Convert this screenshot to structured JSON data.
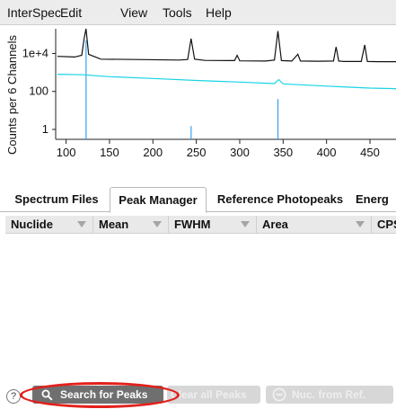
{
  "menubar": {
    "items": [
      "InterSpec",
      "Edit",
      "View",
      "Tools",
      "Help"
    ]
  },
  "chart_data": {
    "type": "line",
    "ylabel": "Counts per 6 Channels",
    "yscale": "log",
    "ylim": [
      0.3,
      200000
    ],
    "y_ticks": [
      1,
      100,
      10000
    ],
    "y_tick_labels": [
      "1",
      "100",
      "1e+4"
    ],
    "xlim": [
      88,
      480
    ],
    "x_ticks": [
      100,
      150,
      200,
      250,
      300,
      350,
      400,
      450
    ],
    "series": [
      {
        "color": "#111111",
        "x": [
          90,
          110,
          118,
          121,
          123,
          126,
          140,
          180,
          230,
          240,
          244,
          248,
          260,
          294,
          297,
          300,
          330,
          340,
          344,
          348,
          360,
          367,
          370,
          390,
          408,
          411,
          414,
          420,
          440,
          444,
          447,
          460,
          480
        ],
        "y": [
          7000,
          6500,
          8000,
          70000,
          300000,
          9000,
          5000,
          4800,
          4500,
          4800,
          60000,
          5000,
          4300,
          4200,
          8000,
          4100,
          4000,
          4500,
          150000,
          4200,
          4000,
          9000,
          4000,
          3900,
          4000,
          22000,
          4000,
          3800,
          3800,
          28000,
          3800,
          3700,
          3700
        ]
      },
      {
        "color": "#19d3e6",
        "x": [
          90,
          120,
          150,
          200,
          250,
          300,
          340,
          345,
          350,
          400,
          450,
          480
        ],
        "y": [
          800,
          750,
          600,
          480,
          380,
          310,
          260,
          420,
          250,
          190,
          150,
          140
        ]
      }
    ],
    "peak_markers": {
      "color": "#3aa0ee",
      "x": [
        123,
        244,
        344
      ],
      "y": [
        50000,
        1.5,
        40
      ]
    }
  },
  "tabs": [
    {
      "label": "Spectrum Files",
      "active": false
    },
    {
      "label": "Peak Manager",
      "active": true
    },
    {
      "label": "Reference Photopeaks",
      "active": false
    },
    {
      "label": "Energ",
      "active": false
    }
  ],
  "table": {
    "columns": [
      "Nuclide",
      "Mean",
      "FWHM",
      "Area",
      "CPS"
    ],
    "rows": []
  },
  "bottom_bar": {
    "help_label": "?",
    "search_button": "Search for Peaks",
    "clear_button": "Clear all Peaks",
    "nuc_button": "Nuc. from Ref."
  },
  "colors": {
    "highlight_ring": "#e3201b",
    "primary_button": "#6f6f6f",
    "disabled_button": "#d7d7d7"
  }
}
